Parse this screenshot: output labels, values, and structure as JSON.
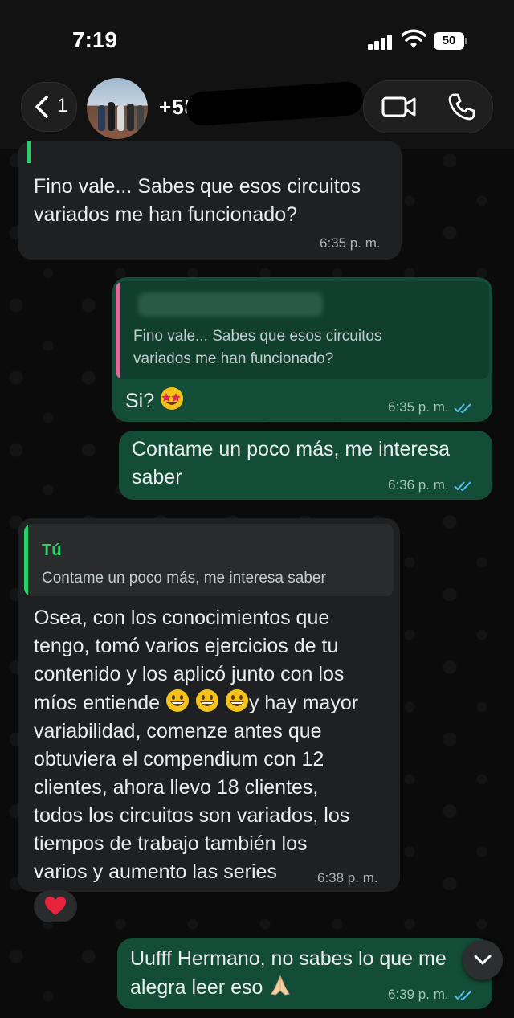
{
  "status_bar": {
    "time": "7:19",
    "battery": "50"
  },
  "header": {
    "back_count": "1",
    "contact_name": "+58"
  },
  "messages": [
    {
      "direction": "incoming",
      "text": "Fino vale... Sabes que esos circuitos\nvariados me han funcionado?",
      "time": "6:35 p. m."
    },
    {
      "direction": "outgoing",
      "quoted_text": "Fino vale... Sabes que esos circuitos\nvariados me han funcionado?",
      "text": "Si?",
      "time": "6:35 p. m.",
      "ticks": "read"
    },
    {
      "direction": "outgoing",
      "text": "Contame un poco más, me interesa\nsaber",
      "time": "6:36 p. m.",
      "ticks": "read"
    },
    {
      "direction": "incoming",
      "quoted_author": "Tú",
      "quoted_text": "Contame un poco más, me interesa saber",
      "text_part1": "Osea, con los conocimientos que\ntengo, tomó varios ejercicios de tu\ncontenido y los aplicó junto con los\nmíos entiende ",
      "text_part2": "y hay mayor\nvariabilidad, comenze antes que\nobtuviera el compendium con 12\nclientes, ahora llevo 18 clientes,\ntodos los circuitos son variados, los\ntiempos de trabajo también los\nvarios y aumento las series",
      "time": "6:38 p. m.",
      "reaction": "heart"
    },
    {
      "direction": "outgoing",
      "text": "Uufff Hermano, no sabes lo que me\nalegra leer eso",
      "time": "6:39 p. m.",
      "ticks": "read"
    }
  ],
  "colors": {
    "incoming_bubble": "#1f2021",
    "outgoing_bubble": "#144d37",
    "quote_bar_green": "#25d366",
    "quote_bar_pink": "#e26a9b",
    "read_ticks": "#53bdeb"
  }
}
